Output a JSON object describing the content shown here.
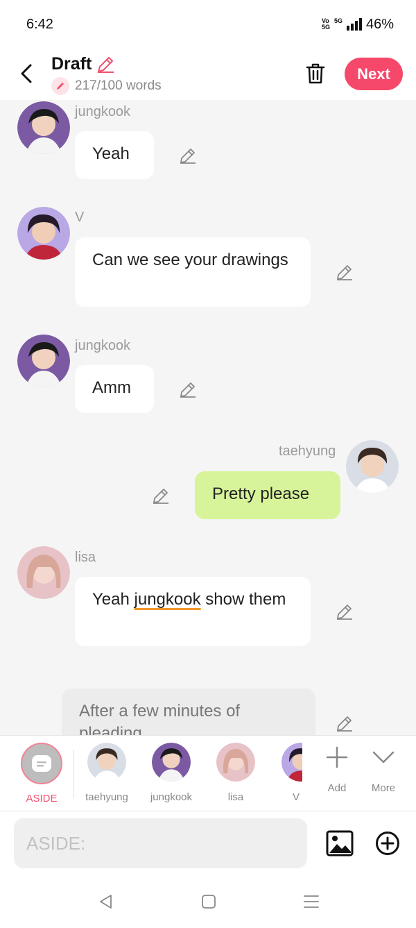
{
  "status": {
    "time": "6:42",
    "volte": [
      "Vo",
      "5G"
    ],
    "network": "5G",
    "battery": "46%"
  },
  "header": {
    "title": "Draft",
    "word_count": "217/100 words",
    "next_label": "Next"
  },
  "messages": [
    {
      "sender": "jungkook",
      "text": "Yeah",
      "side": "left"
    },
    {
      "sender": "V",
      "text": "Can we see your drawings",
      "side": "left"
    },
    {
      "sender": "jungkook",
      "text": "Amm",
      "side": "left"
    },
    {
      "sender": "taehyung",
      "text": "Pretty please",
      "side": "right"
    },
    {
      "sender": "lisa",
      "text_parts": [
        "Yeah ",
        "jungkook",
        " show them"
      ],
      "side": "left"
    },
    {
      "sender": "",
      "text": "After a few minutes of pleading",
      "side": "aside"
    }
  ],
  "characters": {
    "aside": {
      "label": "ASIDE"
    },
    "list": [
      {
        "label": "taehyung"
      },
      {
        "label": "jungkook"
      },
      {
        "label": "lisa"
      },
      {
        "label": "V"
      }
    ],
    "add_label": "Add",
    "more_label": "More"
  },
  "composer": {
    "placeholder": "ASIDE:"
  },
  "colors": {
    "accent": "#f5486a",
    "my_bubble": "#d7f49a",
    "aside_label": "#f0506e"
  }
}
